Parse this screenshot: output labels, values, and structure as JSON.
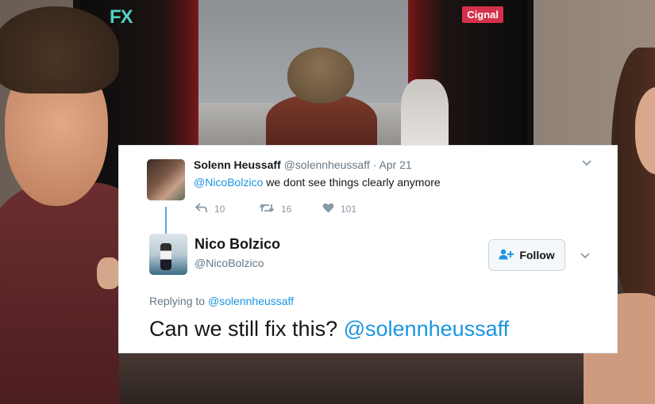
{
  "background": {
    "channel_logo_left": "FX",
    "channel_logo_right": "Cignal"
  },
  "original_tweet": {
    "display_name": "Solenn Heussaff",
    "handle": "@solennheussaff",
    "separator": "·",
    "date": "Apr 21",
    "mention": "@NicoBolzico",
    "text": "we dont see things clearly anymore",
    "reply_count": "10",
    "retweet_count": "16",
    "like_count": "101"
  },
  "reply_tweet": {
    "display_name": "Nico Bolzico",
    "handle": "@NicoBolzico",
    "follow_label": "Follow",
    "replying_prefix": "Replying to",
    "replying_to": "@solennheussaff",
    "text": "Can we still fix this?",
    "mention": "@solennheussaff"
  },
  "colors": {
    "link": "#1b95e0",
    "thread_line": "#5aa8d8",
    "muted": "#657786"
  },
  "icons": [
    "reply-icon",
    "retweet-icon",
    "heart-icon",
    "chevron-down-icon",
    "follow-person-plus-icon"
  ]
}
